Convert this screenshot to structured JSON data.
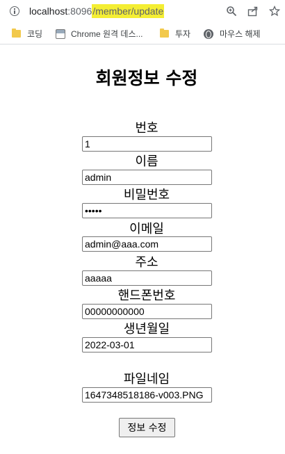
{
  "browser": {
    "url_host": "localhost",
    "url_port": ":8096",
    "url_path": "/member/update",
    "icons": [
      "info-icon",
      "zoom-icon",
      "share-icon",
      "star-icon"
    ]
  },
  "bookmarks": [
    {
      "icon": "folder-icon",
      "label": "코딩"
    },
    {
      "icon": "chrome-remote-desktop-icon",
      "label": "Chrome 원격 데스..."
    },
    {
      "icon": "folder-icon",
      "label": "투자"
    },
    {
      "icon": "globe-icon",
      "label": "마우스 해제"
    }
  ],
  "form": {
    "title": "회원정보 수정",
    "fields": [
      {
        "label": "번호",
        "value": "1"
      },
      {
        "label": "이름",
        "value": "admin"
      },
      {
        "label": "비밀번호",
        "value": "•••••"
      },
      {
        "label": "이메일",
        "value": "admin@aaa.com"
      },
      {
        "label": "주소",
        "value": "aaaaa"
      },
      {
        "label": "핸드폰번호",
        "value": "00000000000"
      },
      {
        "label": "생년월일",
        "value": "2022-03-01"
      },
      {
        "label": "파일네임",
        "value": "1647348518186-v003.PNG"
      }
    ],
    "submit_label": "정보 수정"
  }
}
